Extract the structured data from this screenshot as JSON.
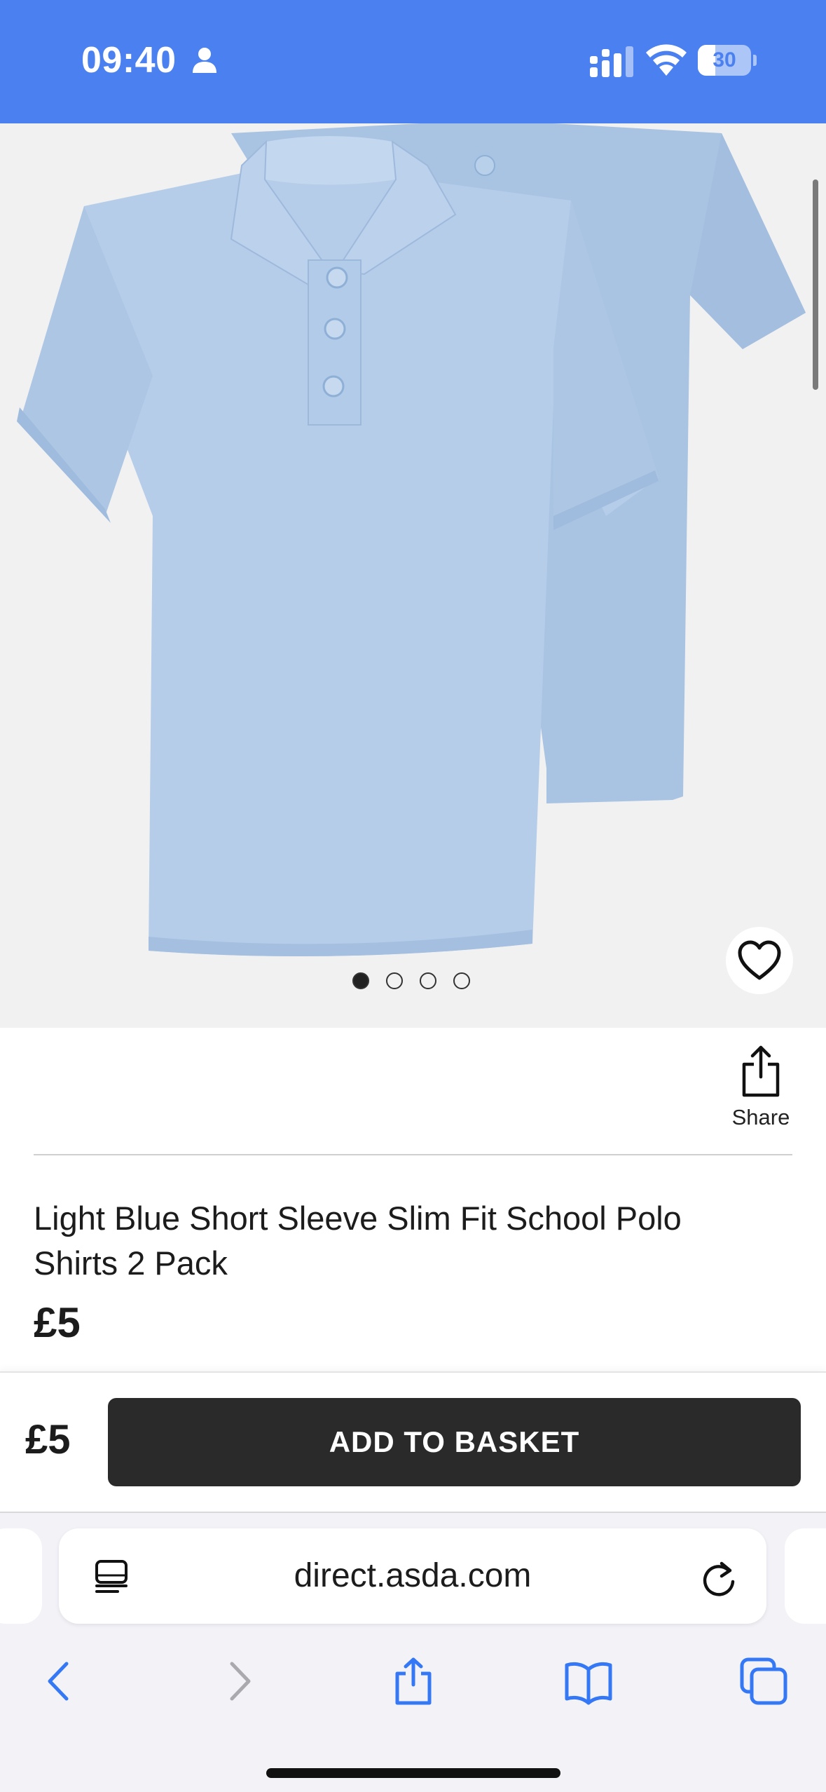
{
  "status_bar": {
    "time": "09:40",
    "battery_level": "30",
    "battery_fraction": 0.3,
    "icons": [
      "person-icon",
      "signal-icon",
      "wifi-icon",
      "battery-icon"
    ]
  },
  "gallery": {
    "image_count": 4,
    "active_index": 0,
    "favourite_icon": "heart-icon"
  },
  "share": {
    "label": "Share",
    "icon": "share-icon"
  },
  "product": {
    "title": "Light Blue Short Sleeve Slim Fit School Polo Shirts 2 Pack",
    "price": "£5"
  },
  "basket_bar": {
    "price": "£5",
    "button_label": "ADD TO BASKET"
  },
  "browser": {
    "url": "direct.asda.com",
    "icons": [
      "reader-icon",
      "reload-icon",
      "back-icon",
      "forward-icon",
      "share-icon",
      "bookmarks-icon",
      "tabs-icon"
    ]
  },
  "colors": {
    "status_bar": "#4a80f0",
    "shirt": "#b7cfe9",
    "button": "#2a2a2a",
    "safari_accent": "#3478f6"
  }
}
